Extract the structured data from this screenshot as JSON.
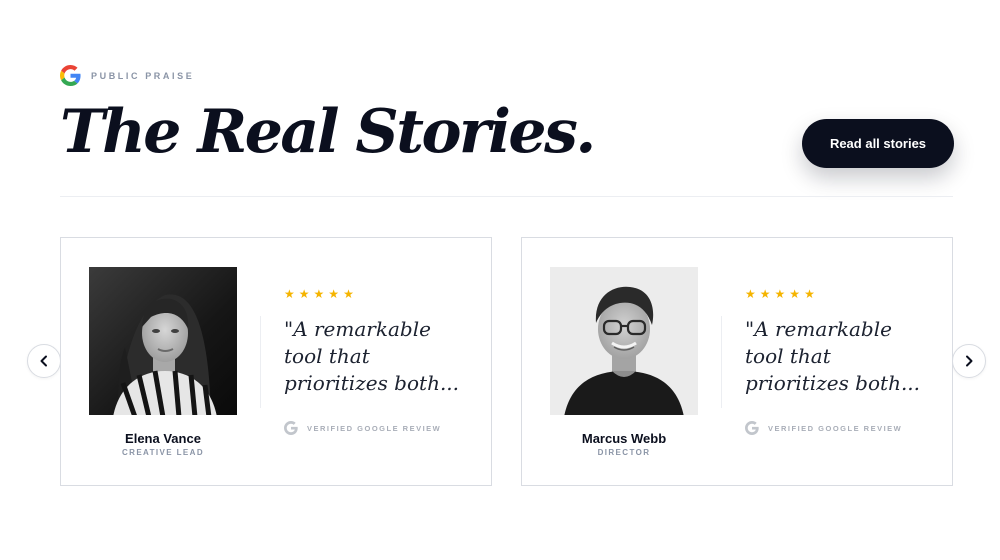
{
  "header": {
    "eyebrow": "PUBLIC PRAISE",
    "title": "The Real Stories.",
    "cta_label": "Read all stories"
  },
  "carousel": {
    "prev_icon": "chevron-left-icon",
    "next_icon": "chevron-right-icon"
  },
  "testimonials": [
    {
      "name": "Elena Vance",
      "role": "CREATIVE LEAD",
      "rating": 5,
      "quote": "\"A remarkable tool that prioritizes both...",
      "badge": "VERIFIED GOOGLE REVIEW"
    },
    {
      "name": "Marcus Webb",
      "role": "DIRECTOR",
      "rating": 5,
      "quote": "\"A remarkable tool that prioritizes both...",
      "badge": "VERIFIED GOOGLE REVIEW"
    }
  ],
  "colors": {
    "ink": "#0b0f1e",
    "star": "#f5b400",
    "muted": "#8a94a6",
    "border": "#d9dce2"
  }
}
